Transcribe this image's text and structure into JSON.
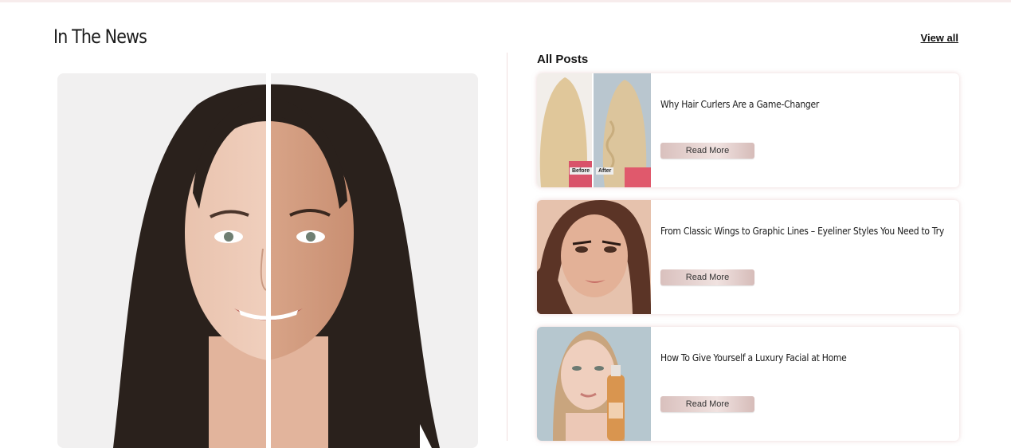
{
  "section": {
    "title": "In The News",
    "view_all_label": "View all"
  },
  "posts_section": {
    "heading": "All Posts",
    "read_more_label": "Read More",
    "posts": [
      {
        "title": "Why Hair Curlers Are a Game-Changer",
        "image_labels": [
          "Before",
          "After"
        ]
      },
      {
        "title": "From Classic Wings to Graphic Lines – Eyeliner Styles You Need to Try"
      },
      {
        "title": "How To Give Yourself a Luxury Facial at Home"
      }
    ]
  },
  "colors": {
    "accent_button": "#e6d3d1",
    "divider": "#f0dede"
  }
}
